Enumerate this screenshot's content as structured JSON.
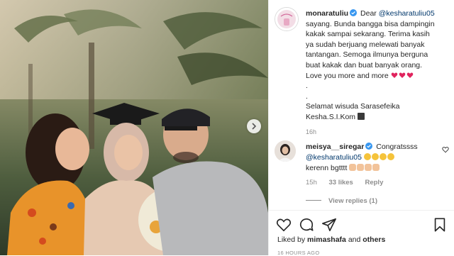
{
  "post": {
    "author": "monaratuliu",
    "caption_lines": [
      "sayang. Bunda bangga bisa dampingin",
      "kakak sampai sekarang. Terima kasih",
      "ya sudah berjuang melewati banyak",
      "tantangan. Semoga ilmunya berguna",
      "buat kakak dan buat banyak orang.",
      "Love you more and more"
    ],
    "caption_first": "Dear",
    "caption_mention": "@kesharatuliu05",
    "caption_dot": ".",
    "caption_footer_1": "Selamat wisuda Sarasefeika",
    "caption_footer_2": "Kesha.S.I.Kom",
    "time": "16h"
  },
  "comment": {
    "author": "meisya__siregar",
    "text_1": "Congratssss",
    "mention": "@kesharatuliu05",
    "text_2": "kerenn bgtttt",
    "time": "15h",
    "likes": "33 likes",
    "reply": "Reply",
    "view_replies": "View replies (1)"
  },
  "footer": {
    "liked_by_prefix": "Liked by",
    "liked_by_user": "mimashafa",
    "liked_by_suffix": "and",
    "liked_by_others": "others",
    "ago": "16 HOURS AGO"
  },
  "icons": {
    "like": "heart-icon",
    "comment": "comment-icon",
    "share": "share-icon",
    "save": "bookmark-icon",
    "next": "chevron-right-icon",
    "verified": "verified-badge-icon"
  },
  "colors": {
    "mention": "#00376b",
    "verified": "#3897f0",
    "meta": "#8e8e8e",
    "emoji_heart": "#e0245e"
  }
}
